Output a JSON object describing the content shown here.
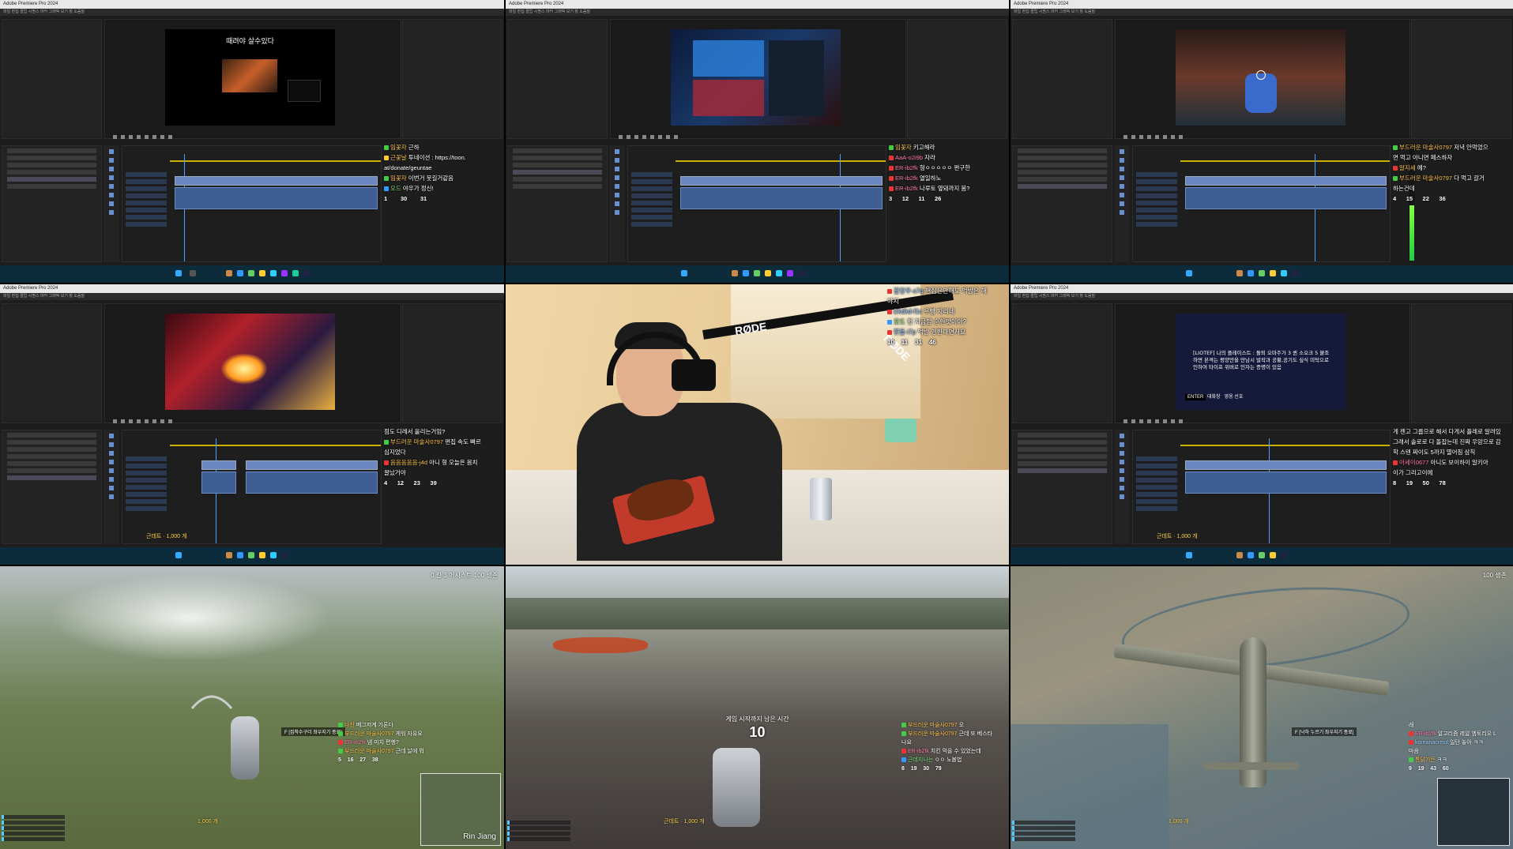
{
  "grid": {
    "tiles": [
      {
        "id": "editor-1",
        "program_caption": "때려야 살수있다",
        "chat": [
          {
            "name": "임꽃자",
            "text": "근하"
          },
          {
            "name": "근꽃날",
            "text": "투네이션 : https://toon."
          },
          {
            "name": "",
            "text": "at/donate/geuntae"
          },
          {
            "name": "임꽃자",
            "text": "이번거 뭇길거같음"
          },
          {
            "name": "오드",
            "text": "야우가 정신!"
          }
        ],
        "stats": [
          "1",
          "30",
          "31"
        ]
      },
      {
        "id": "editor-2",
        "program_caption": "",
        "chat": [
          {
            "name": "임꽃자",
            "text": "키고해라"
          },
          {
            "name": "AaA-o2i9b",
            "text": "자라"
          },
          {
            "name": "ER-ib2fk",
            "text": "형ㅇㅇㅇㅇㅇ 편구한"
          },
          {
            "name": "ER-ib2fk",
            "text": "열일하노"
          },
          {
            "name": "ER-ib2fk",
            "text": "나루토 옆돼까지 봄?"
          }
        ],
        "stats": [
          "3",
          "12",
          "11",
          "26"
        ]
      },
      {
        "id": "editor-3",
        "program_caption": "",
        "chat": [
          {
            "name": "부드러운 마술사0797",
            "text": "저녁 안먹었으"
          },
          {
            "name": "",
            "text": "면 먹고 아니면 페스하자"
          },
          {
            "name": "알지세",
            "text": "예?"
          },
          {
            "name": "부드러운 마술사0797",
            "text": "다 먹고 갈거"
          },
          {
            "name": "",
            "text": "하는건데"
          }
        ],
        "stats": [
          "4",
          "15",
          "22",
          "36"
        ]
      },
      {
        "id": "editor-4",
        "program_caption": "",
        "chat": [
          {
            "name": "",
            "text": "점도 디레서 올리는거임?"
          },
          {
            "name": "부드러운 마술사0797",
            "text": "편집 속도 빠르"
          },
          {
            "name": "",
            "text": "심지었다"
          },
          {
            "name": "음음음음음-j4d",
            "text": "아니 형 오늘은 몸치"
          },
          {
            "name": "",
            "text": "끌났거야"
          }
        ],
        "stats": [
          "4",
          "12",
          "23",
          "39"
        ],
        "coin": "근데트 · 1,000 개"
      },
      {
        "id": "webcam",
        "chat": [
          {
            "name": "갈장우-s7q",
            "text": "편집은안해도 먹방은 해"
          },
          {
            "name": "",
            "text": "야지"
          },
          {
            "name": "Dkdkd-f1c",
            "text": "우빵 자리네"
          },
          {
            "name": "오드",
            "text": "형 지금밥 순한맛이야?"
          },
          {
            "name": "한돌-i7p",
            "text": "먹방 안한다면서요"
          }
        ],
        "stats": [
          "10",
          "11",
          "31",
          "46"
        ],
        "brand_1": "RØDE",
        "brand_2": "RØDE"
      },
      {
        "id": "editor-6",
        "program_caption": "[LIOTEF] 나의 플레이스트 : 돌퇴 오마주가 3 퀸 소오크 5 붙조 하면 본격는 평양만을 만남시 발작과 공황,공기도 싶식 미탁으로 인하여 타이프 위버로 인자는 증명이 있음",
        "enter_label": "ENTER",
        "enter_text": "대화창",
        "mode_text": "영웅 선호",
        "chat": [
          {
            "name": "",
            "text": "게 젠고 그룹으로 해서 다게서 플레로 알려있"
          },
          {
            "name": "",
            "text": "그래서 솔로로 다 돌잡는데 진짜 우앙으로 감"
          },
          {
            "name": "",
            "text": "학 스텐 짜이도 5까지 멸어짐 삼칙"
          },
          {
            "name": "아세이0677",
            "text": "아니도 보이하이 알키아"
          },
          {
            "name": "",
            "text": "이가 그리고이에"
          }
        ],
        "stats": [
          "8",
          "19",
          "50",
          "78"
        ],
        "coin": "근데트 · 1,000 개"
      },
      {
        "id": "game-1",
        "hud_top": "0 킬   3 어시스트   100 생존",
        "prompt": "F  [집착수구더 좌우지기 종료]",
        "chat": [
          {
            "name": "다찬",
            "text": "베그저계 가론다"
          },
          {
            "name": "부드러운 마술사0797",
            "text": "게워 자유요"
          },
          {
            "name": "ER-ib2fk",
            "text": "넴 미치 편행?"
          },
          {
            "name": "부드러운 마술사0797",
            "text": "근데 날에 뭐"
          }
        ],
        "stats": [
          "5",
          "16",
          "27",
          "38"
        ],
        "coin": "1,000 개",
        "minimap_label": "Rin Jiang"
      },
      {
        "id": "game-2",
        "center_text": "게임 시작까지 남은 시간",
        "countdown": "10",
        "chat": [
          {
            "name": "부드러운 마술사0797",
            "text": "오"
          },
          {
            "name": "부드러운 마술사0797",
            "text": "근데 또 베스타"
          },
          {
            "name": "",
            "text": "나요"
          },
          {
            "name": "ER-ib2fk",
            "text": "치킨 먹을 수 있었는데"
          },
          {
            "name": "근데지나는",
            "text": "ㅇㅇ 노볼법"
          }
        ],
        "stats": [
          "8",
          "19",
          "30",
          "79"
        ],
        "coin": "근데트 · 1,000 개"
      },
      {
        "id": "game-3",
        "hud_top": "100 생존",
        "prompt": "F  [낙하 누르기 좌우지기 종료]",
        "chat": [
          {
            "name": "",
            "text": "래"
          },
          {
            "name": "ER-ib2fk",
            "text": "알고리즘 레알 엠토리오 L"
          },
          {
            "name": "koreanacrestl",
            "text": "일단 놓아 ㅋㅋ"
          },
          {
            "name": "",
            "text": "마음"
          },
          {
            "name": "통닭기든",
            "text": "ㅋㅋ"
          }
        ],
        "stats": [
          "9",
          "19",
          "43",
          "60"
        ],
        "coin": "1,000 개"
      }
    ]
  }
}
